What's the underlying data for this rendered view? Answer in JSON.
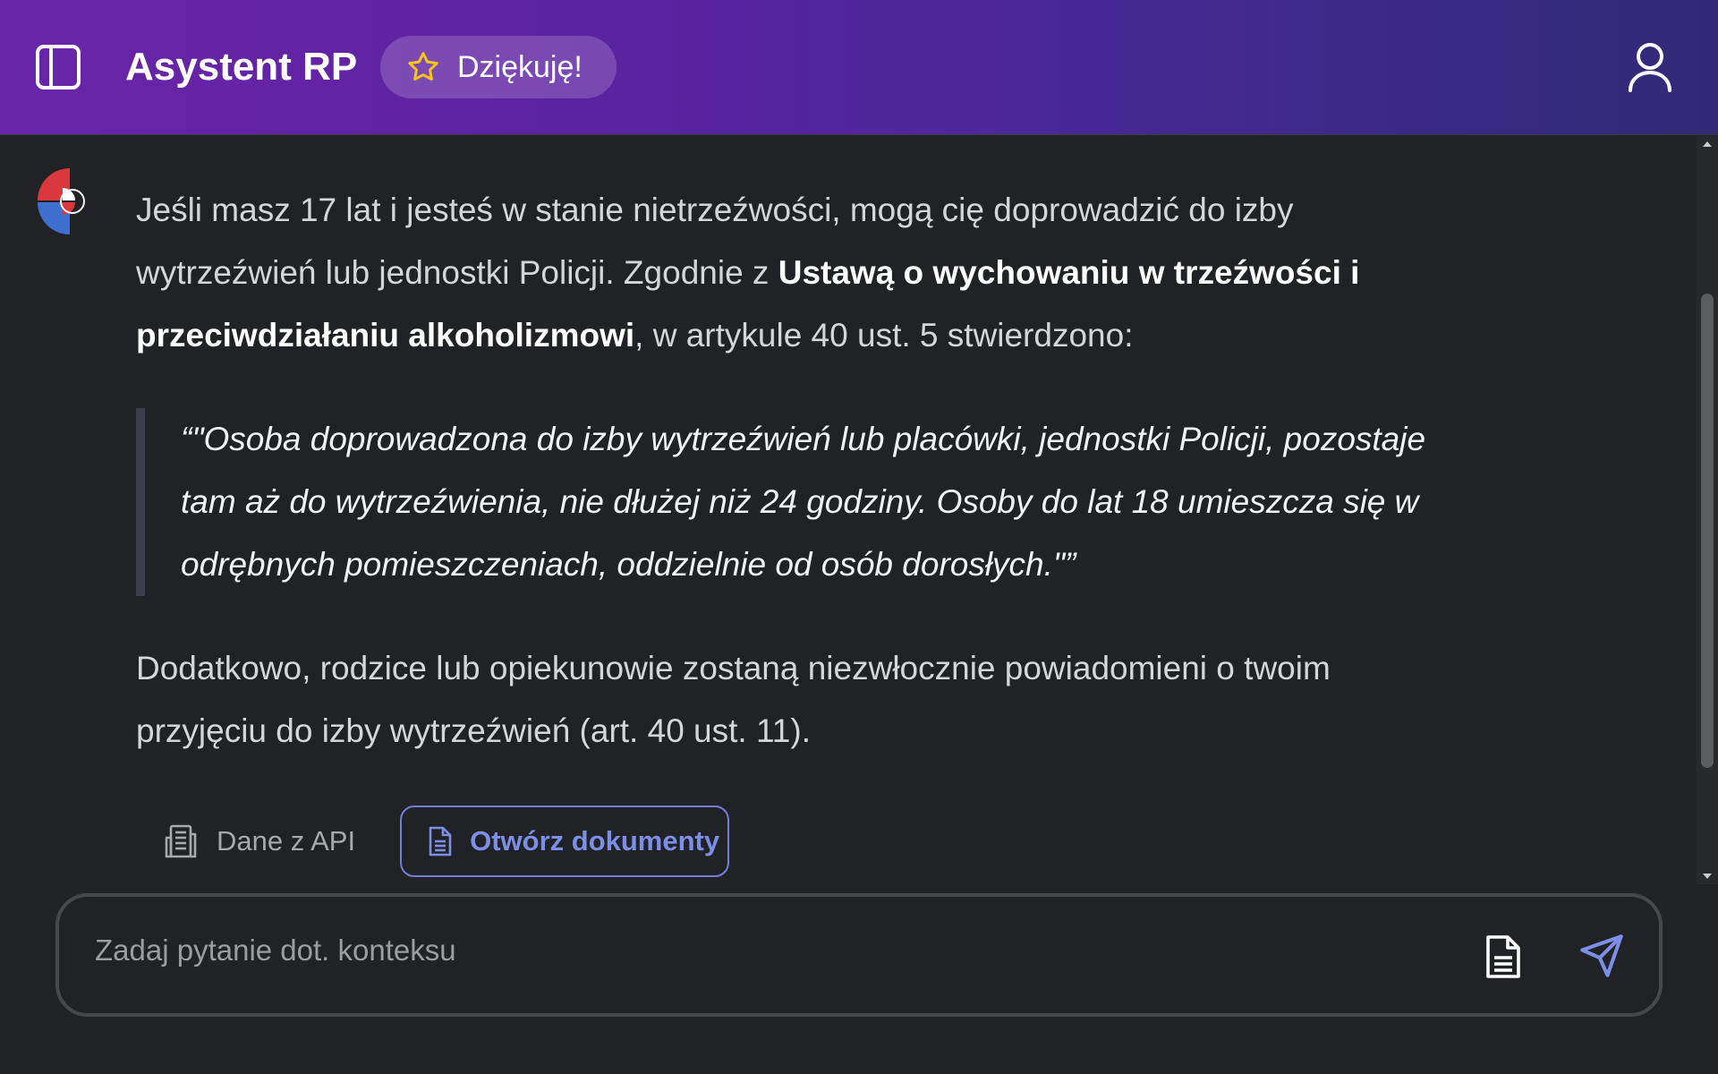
{
  "header": {
    "title": "Asystent RP",
    "thanks_label": "Dziękuję!",
    "icons": {
      "sidebar_toggle": "sidebar-toggle-icon",
      "star": "star-icon",
      "user": "user-icon"
    }
  },
  "message": {
    "p1_before": "Jeśli masz 17 lat i jesteś w stanie nietrzeźwości, mogą cię doprowadzić do izby wytrzeźwień lub jednostki Policji. Zgodnie z ",
    "p1_bold": "Ustawą o wychowaniu w trzeźwości i przeciwdziałaniu alkoholizmowi",
    "p1_after": ", w artykule 40 ust. 5 stwierdzono:",
    "quote": "“\"Osoba doprowadzona do izby wytrzeźwień lub placówki, jednostki Policji, pozostaje tam aż do wytrzeźwienia, nie dłużej niż 24 godziny. Osoby do lat 18 umieszcza się w odrębnych pomieszczeniach, oddzielnie od osób dorosłych.\"”",
    "p2": "Dodatkowo, rodzice lub opiekunowie zostaną niezwłocznie powiadomieni o twoim przyjęciu do izby wytrzeźwień (art. 40 ust. 11)."
  },
  "actions": {
    "api_label": "Dane z API",
    "docs_label": "Otwórz dokumenty"
  },
  "composer": {
    "placeholder": "Zadaj pytanie dot. konteksu",
    "value": ""
  },
  "colors": {
    "header_gradient_start": "#6a25a8",
    "header_gradient_end": "#322a78",
    "background": "#202225",
    "accent_link": "#7d8ee6",
    "logo_red": "#d9383c",
    "logo_blue": "#3f6fd1"
  }
}
